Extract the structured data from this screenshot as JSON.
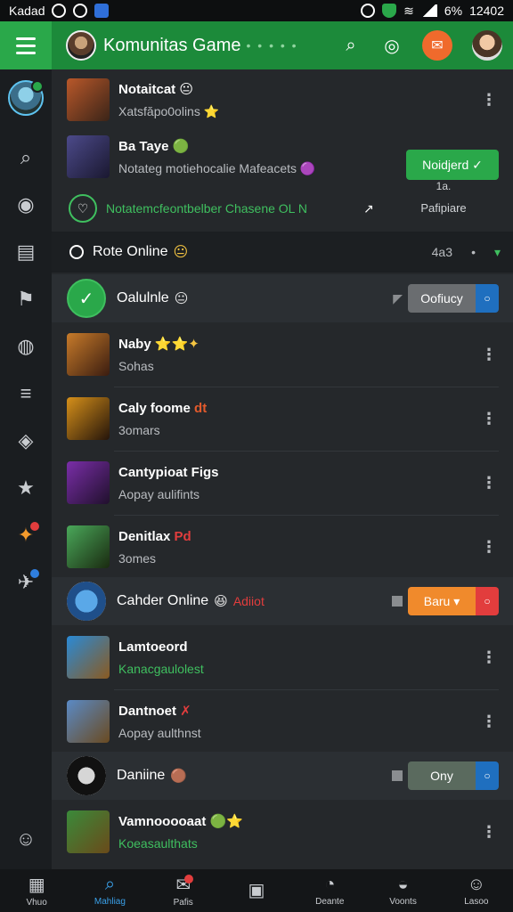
{
  "status": {
    "left_text": "Kadad",
    "battery": "6%",
    "time": "12402"
  },
  "app": {
    "title": "Komunitas Game",
    "title_dots": "• • • • •"
  },
  "feed_top": [
    {
      "title": "Notaitcat",
      "title_emoji": "😐",
      "subtitle": "Xatsfăpo0olins ⭐",
      "colors": [
        "#b9582a",
        "#3a2418"
      ]
    },
    {
      "title": "Ba Taye",
      "title_emoji": "🟢",
      "subtitle": "Notateg motiehocalie Mafeacets 🟣",
      "colors": [
        "#4c4a8a",
        "#1a1830"
      ]
    }
  ],
  "join_button": {
    "label": "Noidjerd ✓",
    "sub1": "1a.",
    "sub2": "Pafipiare"
  },
  "promo": {
    "text": "Notatemcfeontbelber Chasene OL N",
    "arrow": "↗"
  },
  "section": {
    "label": "Rote Online",
    "emoji": "😐",
    "count": "4a3",
    "dot": "•",
    "chevron": "▾"
  },
  "group1": {
    "label": "Oalulnle",
    "emoji": "😐",
    "button": "Oofiucy",
    "end": "○"
  },
  "list1": [
    {
      "title": "Naby",
      "title_emoji": "⭐⭐✦",
      "subtitle": "Sohas",
      "colors": [
        "#c77b2a",
        "#3a1c10"
      ]
    },
    {
      "title": "Caly foome",
      "title_emoji": "dt",
      "subtitle": "3omars",
      "colors": [
        "#d6901a",
        "#24140a"
      ]
    },
    {
      "title": "Cantypioat Figs",
      "title_emoji": "",
      "subtitle": "Aopay aulifints",
      "colors": [
        "#7a2ea8",
        "#20102c"
      ]
    },
    {
      "title": "Denitlax",
      "title_emoji": "Pd",
      "subtitle": "3omes",
      "colors": [
        "#4aa85a",
        "#1a2a10"
      ]
    }
  ],
  "group2": {
    "label": "Cahder Online",
    "emoji": "😆",
    "extra": "Adiiot",
    "button": "Baru ▾",
    "end": "○"
  },
  "list2": [
    {
      "title": "Lamtoeord",
      "title_emoji": "",
      "subtitle": "Kanacgaulolest",
      "subtitle_green": true,
      "colors": [
        "#2a8ad6",
        "#8a5a20"
      ]
    },
    {
      "title": "Dantnoet",
      "title_emoji": "✗",
      "subtitle": "Aopay aulthnst",
      "subtitle_green": false,
      "colors": [
        "#5a8ac6",
        "#6a4a20"
      ]
    }
  ],
  "group3": {
    "label": "Daniine",
    "emoji": "🟤",
    "button": "Ony",
    "end": "○"
  },
  "list3": [
    {
      "title": "Vamnooooaat",
      "title_emoji": "🟢⭐",
      "subtitle": "Koeasaulthats",
      "subtitle_green": true,
      "colors": [
        "#3a8a3a",
        "#6a4a1a"
      ]
    }
  ],
  "bottom_nav": [
    {
      "label": "Vhuo",
      "icon": "▦"
    },
    {
      "label": "Mahliag",
      "icon": "⌕",
      "active": true
    },
    {
      "label": "Pafis",
      "icon": "✉",
      "badge": true
    },
    {
      "label": "",
      "icon": "▣"
    },
    {
      "label": "Deante",
      "icon": "◔"
    },
    {
      "label": "Voonts",
      "icon": "◒"
    },
    {
      "label": "Lasoo",
      "icon": "☺"
    }
  ]
}
